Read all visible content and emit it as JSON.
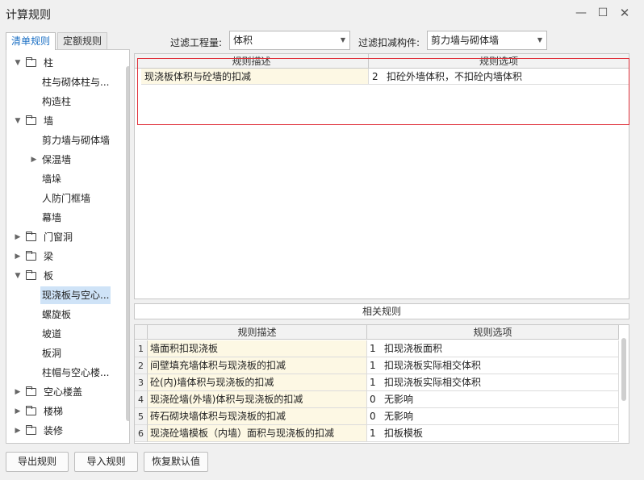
{
  "window": {
    "title": "计算规则"
  },
  "tabs": [
    {
      "label": "清单规则",
      "active": true
    },
    {
      "label": "定额规则",
      "active": false
    }
  ],
  "filters": {
    "quantity_label": "过滤工程量:",
    "quantity_value": "体积",
    "component_label": "过滤扣减构件:",
    "component_value": "剪力墙与砌体墙"
  },
  "tree": {
    "items": [
      {
        "label": "柱",
        "level": 0,
        "arrow": "down",
        "folder": true
      },
      {
        "label": "柱与砌体柱与...",
        "level": 1
      },
      {
        "label": "构造柱",
        "level": 1
      },
      {
        "label": "墙",
        "level": 0,
        "arrow": "down",
        "folder": true
      },
      {
        "label": "剪力墙与砌体墙",
        "level": 1
      },
      {
        "label": "保温墙",
        "level": 1,
        "arrow": "right"
      },
      {
        "label": "墙垛",
        "level": 1
      },
      {
        "label": "人防门框墙",
        "level": 1
      },
      {
        "label": "幕墙",
        "level": 1
      },
      {
        "label": "门窗洞",
        "level": 0,
        "arrow": "right",
        "folder": true
      },
      {
        "label": "梁",
        "level": 0,
        "arrow": "right",
        "folder": true
      },
      {
        "label": "板",
        "level": 0,
        "arrow": "down",
        "folder": true
      },
      {
        "label": "现浇板与空心...",
        "level": 1,
        "selected": true
      },
      {
        "label": "螺旋板",
        "level": 1
      },
      {
        "label": "坡道",
        "level": 1
      },
      {
        "label": "板洞",
        "level": 1
      },
      {
        "label": "柱帽与空心楼...",
        "level": 1
      },
      {
        "label": "空心楼盖",
        "level": 0,
        "arrow": "right",
        "folder": true
      },
      {
        "label": "楼梯",
        "level": 0,
        "arrow": "right",
        "folder": true
      },
      {
        "label": "装修",
        "level": 0,
        "arrow": "right",
        "folder": true
      }
    ]
  },
  "top_grid": {
    "headers": [
      "规则描述",
      "规则选项"
    ],
    "rows": [
      {
        "desc": "现浇板体积与砼墙的扣减",
        "option_num": "2",
        "option_text": "扣砼外墙体积，不扣砼内墙体积"
      }
    ]
  },
  "related": {
    "label": "相关规则"
  },
  "bottom_grid": {
    "headers": [
      "规则描述",
      "规则选项"
    ],
    "rows": [
      {
        "n": "1",
        "desc": "墙面积扣现浇板",
        "option_num": "1",
        "option_text": "扣现浇板面积"
      },
      {
        "n": "2",
        "desc": "间壁填充墙体积与现浇板的扣减",
        "option_num": "1",
        "option_text": "扣现浇板实际相交体积"
      },
      {
        "n": "3",
        "desc": "砼(内)墙体积与现浇板的扣减",
        "option_num": "1",
        "option_text": "扣现浇板实际相交体积"
      },
      {
        "n": "4",
        "desc": "现浇砼墙(外墙)体积与现浇板的扣减",
        "option_num": "0",
        "option_text": "无影响"
      },
      {
        "n": "5",
        "desc": "砖石砌块墙体积与现浇板的扣减",
        "option_num": "0",
        "option_text": "无影响"
      },
      {
        "n": "6",
        "desc": "现浇砼墙模板（内墙）面积与现浇板的扣减",
        "option_num": "1",
        "option_text": "扣板模板"
      }
    ]
  },
  "buttons": {
    "export": "导出规则",
    "import": "导入规则",
    "restore": "恢复默认值"
  },
  "colors": {
    "accent": "#1a6fc4",
    "highlight": "#e0303a",
    "selection": "#cfe3f7",
    "desc_bg": "#fdf8e4"
  }
}
